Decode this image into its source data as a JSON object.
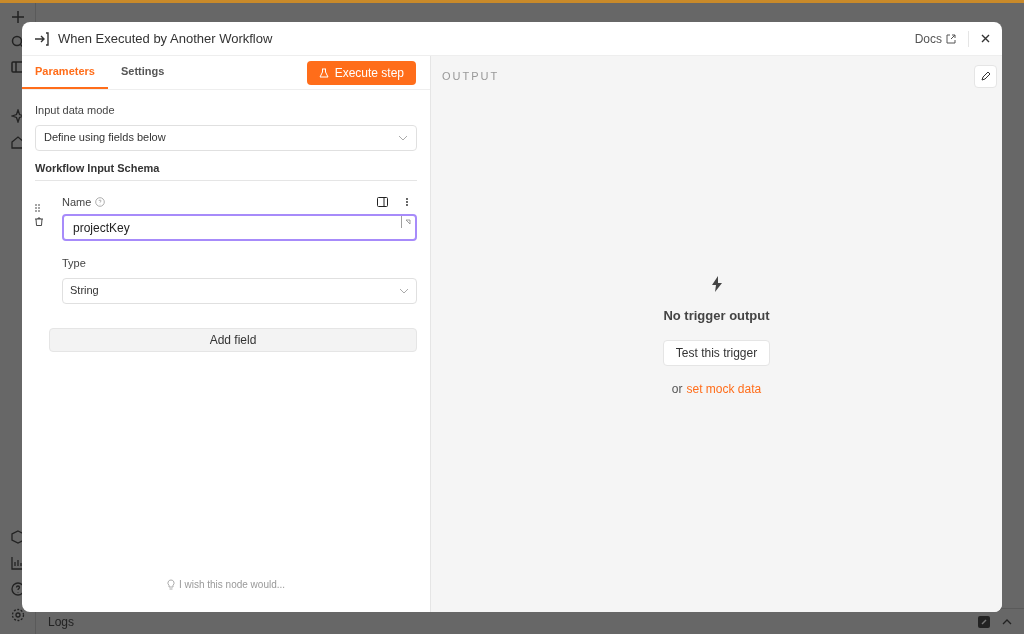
{
  "dialog": {
    "title": "When Executed by Another Workflow",
    "docs_link": "Docs",
    "tabs": [
      {
        "label": "Parameters",
        "selected": true
      },
      {
        "label": "Settings",
        "selected": false
      }
    ],
    "execute_button": "Execute step",
    "input_data_mode": {
      "label": "Input data mode",
      "value": "Define using fields below"
    },
    "schema": {
      "heading": "Workflow Input Schema",
      "fields": [
        {
          "name_label": "Name",
          "name_value": "projectKey",
          "type_label": "Type",
          "type_value": "String"
        }
      ],
      "add_button": "Add field"
    },
    "feedback": "I wish this node would...",
    "output": {
      "heading": "OUTPUT",
      "empty_title": "No trigger output",
      "test_button": "Test this trigger",
      "or_text": "or",
      "mock_link": "set mock data"
    }
  },
  "logs_bar": {
    "label": "Logs"
  }
}
